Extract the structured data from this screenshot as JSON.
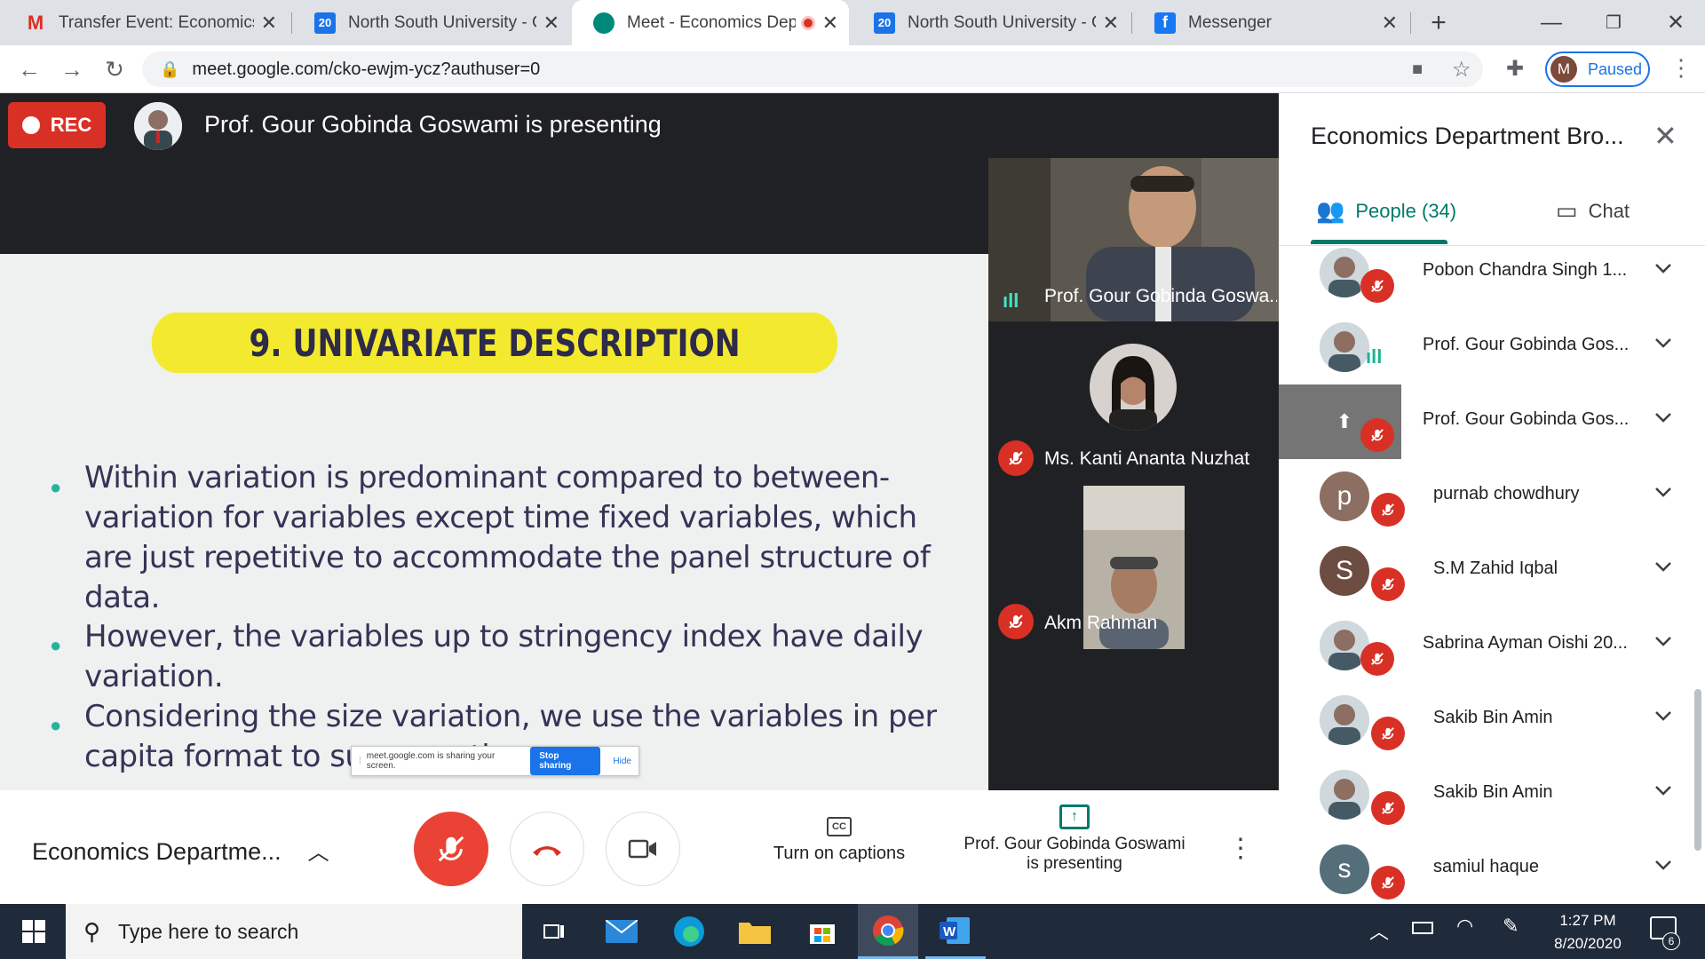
{
  "browser": {
    "tabs": [
      {
        "title": "Transfer Event: Economics D",
        "icon": "gmail-icon",
        "active": false
      },
      {
        "title": "North South University - Ca",
        "icon": "calendar-icon",
        "active": false
      },
      {
        "title": "Meet - Economics Dep",
        "icon": "meet-icon",
        "active": true
      },
      {
        "title": "North South University - Ca",
        "icon": "calendar-icon",
        "active": false
      },
      {
        "title": "Messenger",
        "icon": "facebook-icon",
        "active": false
      }
    ],
    "calendar_day": "20",
    "url": "meet.google.com/cko-ewjm-ycz?authuser=0",
    "profile_initial": "M",
    "profile_status": "Paused"
  },
  "meet": {
    "rec_label": "REC",
    "presenting_banner": "Prof. Gour Gobinda Goswami is presenting",
    "slide": {
      "title": "9. UNIVARIATE DESCRIPTION",
      "bullets": [
        "Within variation is predominant compared to between-variation for variables except time fixed variables, which are just repetitive to accommodate the panel structure of data.",
        "However, the variables up to stringency index have daily variation.",
        "Considering the size variation, we use the variables in per capita format to suppress th"
      ]
    },
    "share_notice": {
      "text": "meet.google.com is sharing your screen.",
      "stop": "Stop sharing",
      "hide": "Hide"
    },
    "tiles": [
      {
        "name": "Prof. Gour Gobinda Goswa..."
      },
      {
        "name": "Ms. Kanti Ananta Nuzhat"
      },
      {
        "name": "Akm Rahman"
      }
    ],
    "bottom": {
      "meeting_name": "Economics Departme...",
      "captions_label": "Turn on captions",
      "presenting_label_1": "Prof. Gour Gobinda Goswami",
      "presenting_label_2": "is presenting"
    }
  },
  "panel": {
    "title": "Economics Department Bro...",
    "people_tab": "People (34)",
    "chat_tab": "Chat",
    "people": [
      {
        "name": "Pobon Chandra Singh 1...",
        "avatar": "photo",
        "mic": "off"
      },
      {
        "name": "Prof. Gour Gobinda Gos...",
        "avatar": "photo",
        "mic": "speaking"
      },
      {
        "name": "Prof. Gour Gobinda Gos...",
        "avatar": "presentation",
        "mic": "off"
      },
      {
        "name": "purnab chowdhury",
        "avatar": "p",
        "mic": "off"
      },
      {
        "name": "S.M Zahid Iqbal",
        "avatar": "S",
        "mic": "off"
      },
      {
        "name": "Sabrina Ayman Oishi 20...",
        "avatar": "photo",
        "mic": "off"
      },
      {
        "name": "Sakib Bin Amin",
        "avatar": "photo",
        "mic": "off"
      },
      {
        "name": "Sakib Bin Amin",
        "avatar": "photo",
        "mic": "off"
      },
      {
        "name": "samiul haque",
        "avatar": "s",
        "mic": "off"
      }
    ]
  },
  "taskbar": {
    "search_placeholder": "Type here to search",
    "time": "1:27 PM",
    "date": "8/20/2020",
    "notification_count": "6"
  },
  "colors": {
    "meet_dark": "#202124",
    "rec_red": "#d93025",
    "slide_title_yellow": "#f3ea2f",
    "slide_bullet_teal": "#27b39b",
    "accent_teal": "#00796b"
  }
}
